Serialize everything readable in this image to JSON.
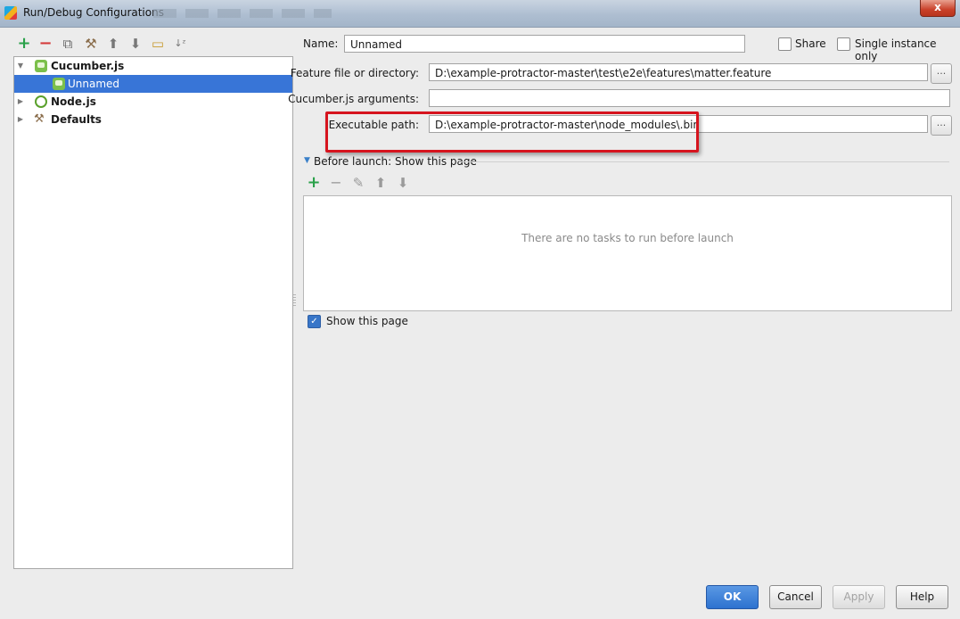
{
  "window": {
    "title": "Run/Debug Configurations",
    "close_glyph": "x"
  },
  "toolbar": {
    "icons": [
      "plus-icon",
      "minus-icon",
      "copy-icon",
      "wrench-icon",
      "arrow-up-icon",
      "arrow-down-icon",
      "folder-icon",
      "sort-az-icon"
    ]
  },
  "tree": {
    "cucumber": "Cucumber.js",
    "unnamed": "Unnamed",
    "node": "Node.js",
    "defaults": "Defaults"
  },
  "form": {
    "name_label": "Name:",
    "name_value": "Unnamed",
    "share_label": "Share",
    "single_instance_label": "Single instance only",
    "feature_label": "Feature file or directory:",
    "feature_value": "D:\\example-protractor-master\\test\\e2e\\features\\matter.feature",
    "args_label": "Cucumber.js arguments:",
    "args_value": "",
    "exec_label": "Executable path:",
    "exec_value": "D:\\example-protractor-master\\node_modules\\.bin",
    "browse_glyph": "..."
  },
  "before_launch": {
    "header": "Before launch: Show this page",
    "empty_message": "There are no tasks to run before launch",
    "show_page_label": "Show this page"
  },
  "buttons": {
    "ok": "OK",
    "cancel": "Cancel",
    "apply": "Apply",
    "help": "Help"
  },
  "colors": {
    "accent": "#3875d7",
    "highlight_box": "#d6141e",
    "add_green": "#2aa14a",
    "remove_red": "#d53b3b"
  }
}
